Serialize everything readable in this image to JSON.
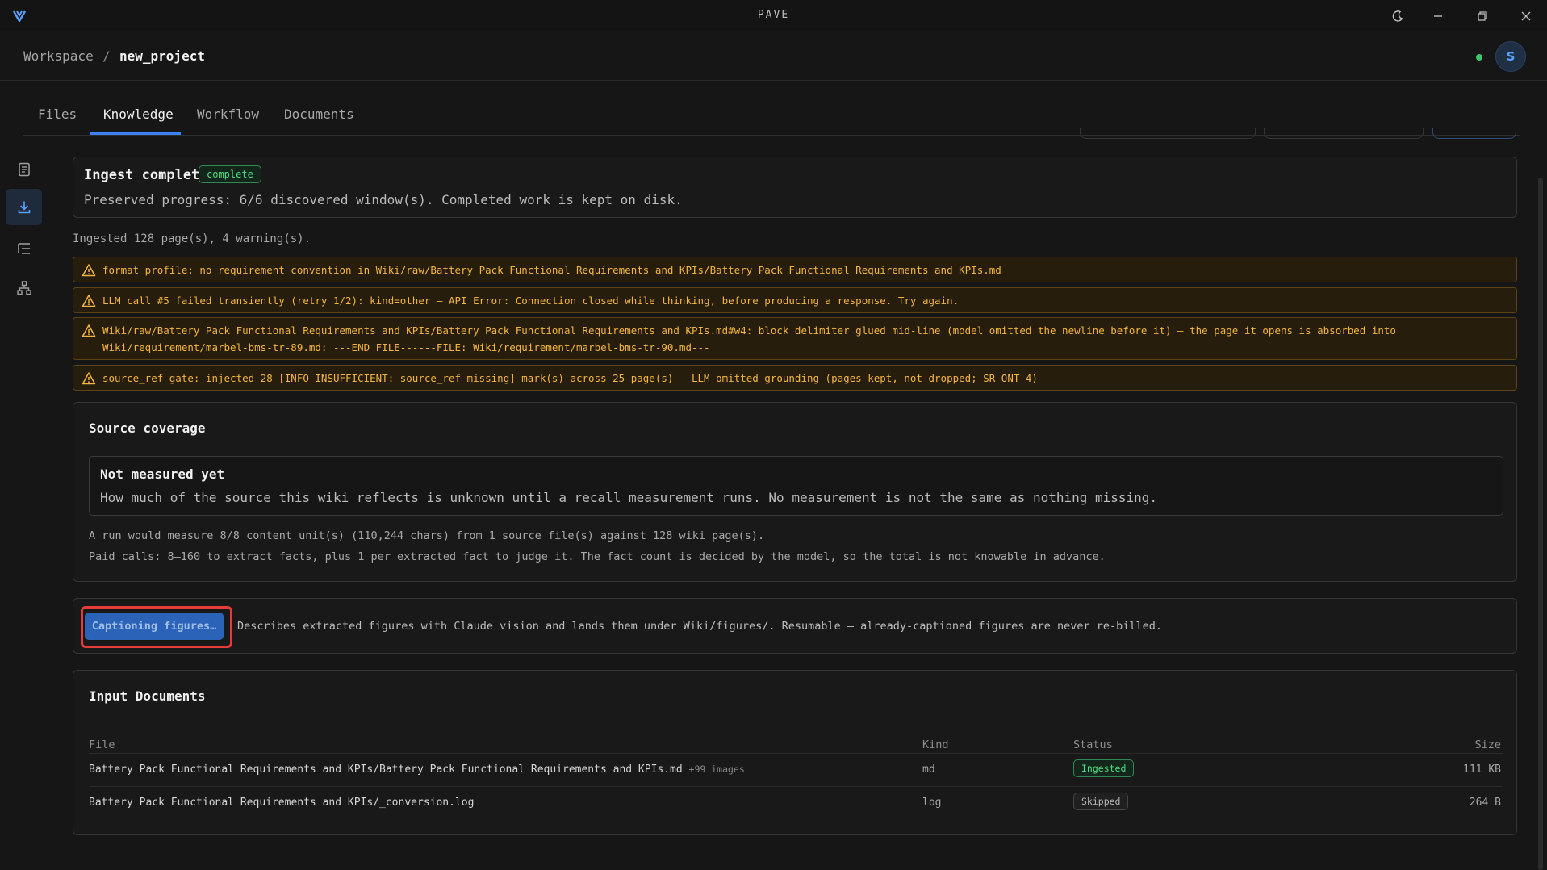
{
  "app": {
    "title": "PAVE"
  },
  "breadcrumb": {
    "root": "Workspace",
    "separator": "/",
    "current": "new_project"
  },
  "user": {
    "avatar_initial": "S"
  },
  "tabs": [
    {
      "label": "Files"
    },
    {
      "label": "Knowledge",
      "active": true
    },
    {
      "label": "Workflow"
    },
    {
      "label": "Documents"
    }
  ],
  "sidebar": {
    "items": [
      {
        "icon": "document-icon"
      },
      {
        "icon": "download-icon",
        "active": true
      },
      {
        "icon": "list-tree-icon"
      },
      {
        "icon": "hierarchy-icon"
      }
    ]
  },
  "ingest": {
    "title": "Ingest complete",
    "badge": "complete",
    "subtitle": "Preserved progress: 6/6 discovered window(s). Completed work is kept on disk.",
    "summary": "Ingested 128 page(s), 4 warning(s)."
  },
  "warnings": [
    "format profile: no requirement convention in Wiki/raw/Battery Pack Functional Requirements and KPIs/Battery Pack Functional Requirements and KPIs.md",
    "LLM call #5 failed transiently (retry 1/2): kind=other — API Error: Connection closed while thinking, before producing a response. Try again.",
    "Wiki/raw/Battery Pack Functional Requirements and KPIs/Battery Pack Functional Requirements and KPIs.md#w4: block delimiter glued mid-line (model omitted the newline before it) — the page it opens is absorbed into Wiki/requirement/marbel-bms-tr-89.md: ---END FILE------FILE: Wiki/requirement/marbel-bms-tr-90.md---",
    "source_ref gate: injected 28 [INFO-INSUFFICIENT: source_ref missing] mark(s) across 25 page(s) — LLM omitted grounding (pages kept, not dropped; SR-ONT-4)"
  ],
  "coverage": {
    "title": "Source coverage",
    "box_title": "Not measured yet",
    "box_text": "How much of the source this wiki reflects is unknown until a recall measurement runs. No measurement is not the same as nothing missing.",
    "line1": "A run would measure 8/8 content unit(s) (110,244 chars) from 1 source file(s) against 128 wiki page(s).",
    "line2": "Paid calls: 8–160 to extract facts, plus 1 per extracted fact to judge it. The fact count is decided by the model, so the total is not knowable in advance."
  },
  "captioning": {
    "button_label": "Captioning figures…",
    "description": "Describes extracted figures with Claude vision and lands them under Wiki/figures/. Resumable — already-captioned figures are never re-billed."
  },
  "input_documents": {
    "title": "Input Documents",
    "columns": {
      "file": "File",
      "kind": "Kind",
      "status": "Status",
      "size": "Size"
    },
    "rows": [
      {
        "file": "Battery Pack Functional Requirements and KPIs/Battery Pack Functional Requirements and KPIs.md",
        "extra": "+99 images",
        "kind": "md",
        "status": "Ingested",
        "size": "111 KB"
      },
      {
        "file": "Battery Pack Functional Requirements and KPIs/_conversion.log",
        "extra": "",
        "kind": "log",
        "status": "Skipped",
        "size": "264 B"
      }
    ]
  },
  "colors": {
    "accent": "#3b82f6",
    "success": "#4ade80",
    "warning": "#f4b53f",
    "highlight": "#e63b3b"
  }
}
